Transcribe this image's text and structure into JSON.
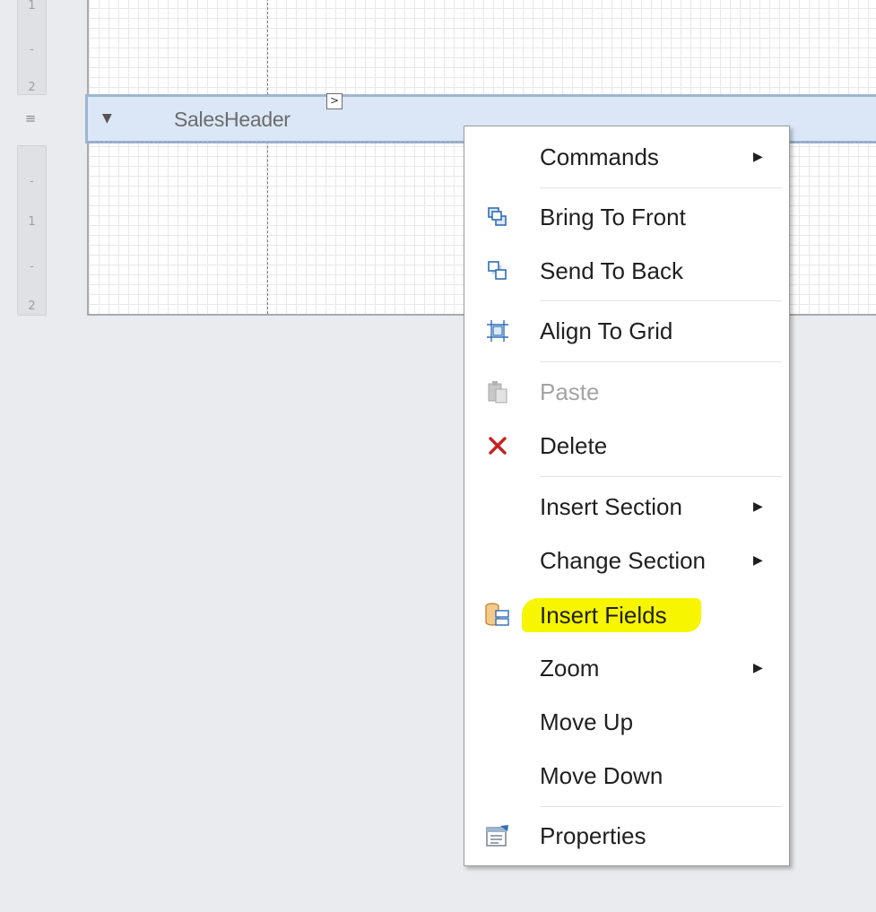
{
  "ruler": {
    "top_marks": [
      "1",
      "-",
      "2"
    ],
    "bottom_marks": [
      "-",
      "1",
      "-",
      "2"
    ],
    "handle_glyph": "≡"
  },
  "band": {
    "label": "SalesHeader",
    "collapse_glyph": "▼",
    "smart_tag_glyph": ">"
  },
  "context_menu": {
    "items": [
      {
        "label": "Commands",
        "icon": "none",
        "submenu": true
      },
      {
        "label": "Bring To Front",
        "icon": "bring-to-front-icon"
      },
      {
        "label": "Send To Back",
        "icon": "send-to-back-icon"
      },
      {
        "label": "Align To Grid",
        "icon": "align-to-grid-icon"
      },
      {
        "label": "Paste",
        "icon": "paste-icon",
        "disabled": true
      },
      {
        "label": "Delete",
        "icon": "delete-icon"
      },
      {
        "label": "Insert Section",
        "icon": "none",
        "submenu": true
      },
      {
        "label": "Change Section",
        "icon": "none",
        "submenu": true
      },
      {
        "label": "Insert Fields",
        "icon": "insert-fields-icon",
        "highlighted": true
      },
      {
        "label": "Zoom",
        "icon": "none",
        "submenu": true
      },
      {
        "label": "Move Up",
        "icon": "none"
      },
      {
        "label": "Move Down",
        "icon": "none"
      },
      {
        "label": "Properties",
        "icon": "properties-icon"
      }
    ],
    "submenu_glyph": "▶"
  },
  "colors": {
    "band_fill": "#dbe7f7",
    "highlight": "#f7f500",
    "delete_red": "#c8201f",
    "icon_blue": "#2f6eb5"
  }
}
